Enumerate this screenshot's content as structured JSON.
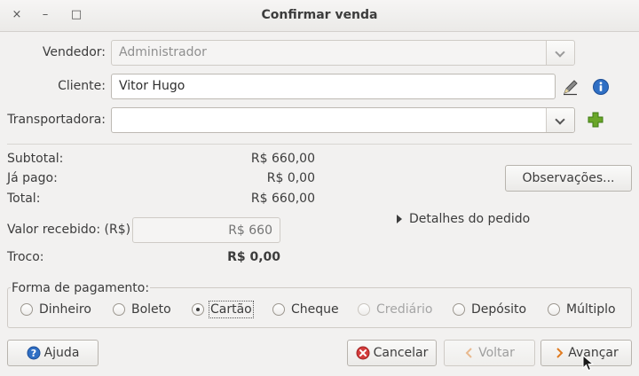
{
  "window": {
    "title": "Confirmar venda",
    "close_glyph": "×",
    "minimize_glyph": "–",
    "maximize_glyph": "□"
  },
  "form": {
    "vendedor_label": "Vendedor:",
    "vendedor_value": "Administrador",
    "cliente_label": "Cliente:",
    "cliente_value": "Vitor Hugo",
    "transportadora_label": "Transportadora:",
    "transportadora_value": ""
  },
  "icons": {
    "edit": "pencil-icon",
    "info": "info-icon",
    "add": "plus-icon",
    "help": "help-icon",
    "cancel": "cancel-icon",
    "back": "chevron-left-icon",
    "next": "chevron-right-icon"
  },
  "totals": {
    "subtotal_label": "Subtotal:",
    "subtotal_value": "R$ 660,00",
    "ja_pago_label": "Já pago:",
    "ja_pago_value": "R$ 0,00",
    "total_label": "Total:",
    "total_value": "R$ 660,00",
    "valor_recebido_label": "Valor recebido: (R$)",
    "valor_recebido_placeholder": "R$ 660",
    "troco_label": "Troco:",
    "troco_value": "R$ 0,00"
  },
  "buttons": {
    "observacoes": "Observações...",
    "detalhes": "Detalhes do pedido",
    "ajuda": "Ajuda",
    "cancelar": "Cancelar",
    "voltar": "Voltar",
    "avancar": "Avançar"
  },
  "payment": {
    "label": "Forma de pagamento:",
    "options": [
      {
        "label": "Dinheiro",
        "checked": false,
        "enabled": true
      },
      {
        "label": "Boleto",
        "checked": false,
        "enabled": true
      },
      {
        "label": "Cartão",
        "checked": true,
        "enabled": true
      },
      {
        "label": "Cheque",
        "checked": false,
        "enabled": true
      },
      {
        "label": "Crediário",
        "checked": false,
        "enabled": false
      },
      {
        "label": "Depósito",
        "checked": false,
        "enabled": true
      },
      {
        "label": "Múltiplo",
        "checked": false,
        "enabled": true
      }
    ]
  },
  "colors": {
    "accent_green": "#6aa628",
    "info_blue": "#2f6fc4",
    "cancel_red": "#d33b3b",
    "next_orange": "#e07b20"
  }
}
